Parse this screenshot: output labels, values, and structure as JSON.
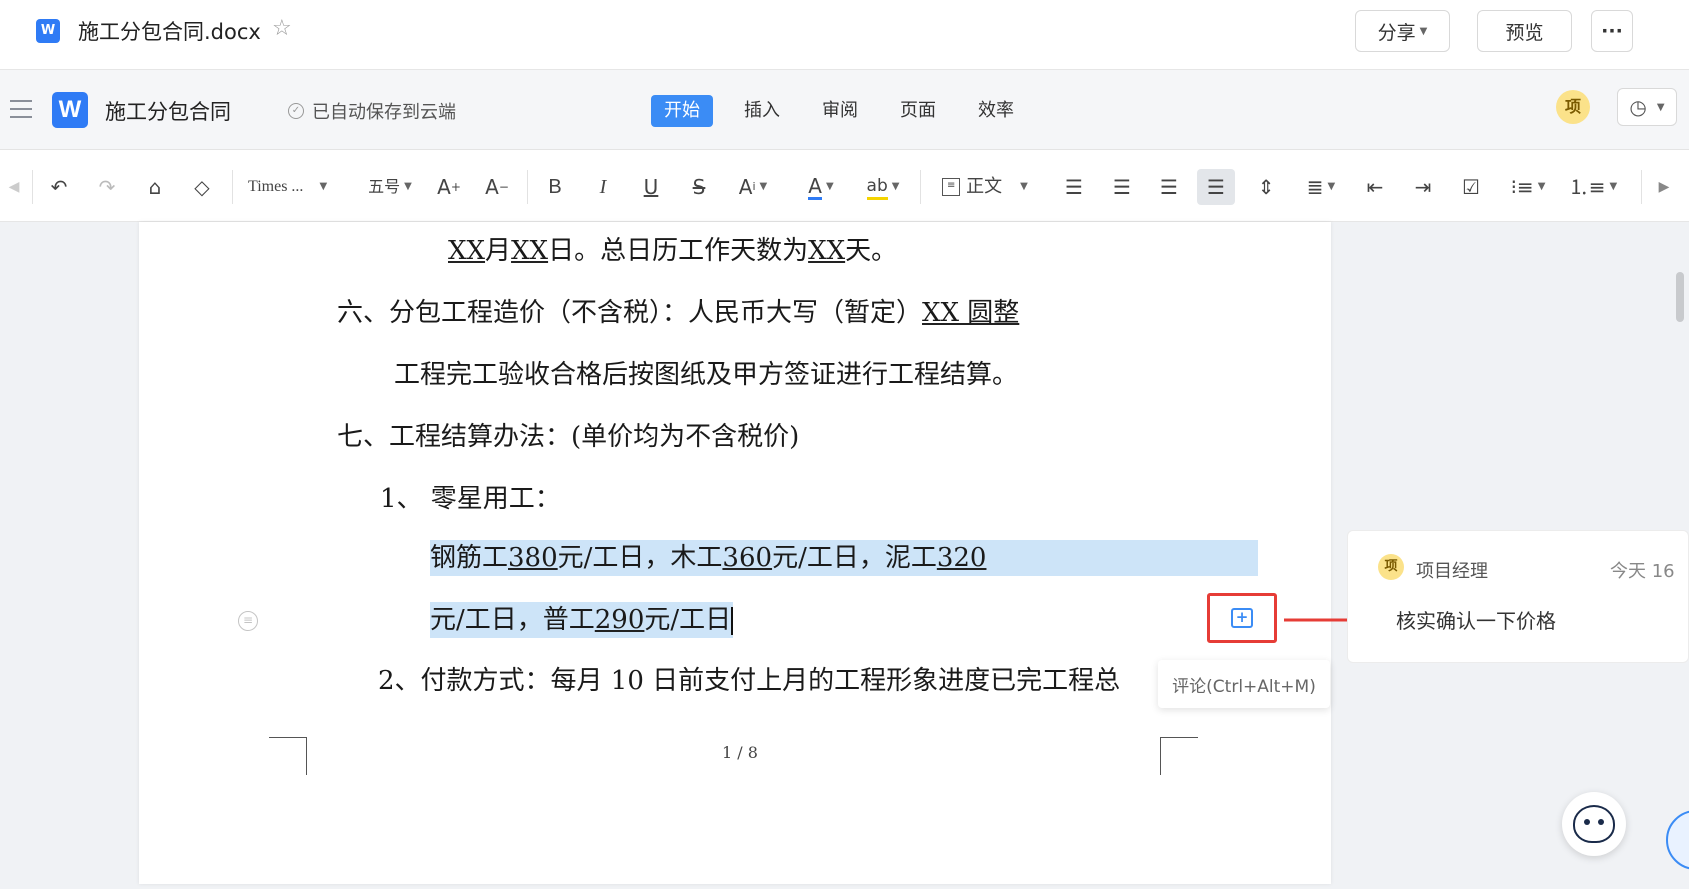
{
  "titlebar": {
    "doc_icon": "W",
    "doc_name": "施工分包合同.docx",
    "share_label": "分享",
    "preview_label": "预览",
    "more_label": "···"
  },
  "menubar": {
    "app_title": "施工分包合同",
    "save_status": "已自动保存到云端",
    "tabs": [
      "开始",
      "插入",
      "审阅",
      "页面",
      "效率"
    ],
    "active_tab": "开始",
    "avatar_label": "项"
  },
  "toolbar": {
    "font_name": "Times ...",
    "font_size": "五号",
    "paragraph_style": "正文",
    "icons": [
      "undo-icon",
      "redo-icon",
      "format-painter-icon",
      "eraser-icon",
      "grow-font-icon",
      "shrink-font-icon",
      "bold-icon",
      "italic-icon",
      "underline-icon",
      "strikethrough-icon",
      "superscript-icon",
      "font-color-icon",
      "highlight-icon",
      "align-left-icon",
      "align-center-icon",
      "align-right-icon",
      "justify-icon",
      "line-spacing-icon",
      "paragraph-spacing-icon",
      "outdent-icon",
      "indent-icon",
      "checklist-icon",
      "bullet-list-icon",
      "numbered-list-icon"
    ],
    "font_color": "#2f7bf5",
    "highlight_color": "#f5d400"
  },
  "document": {
    "line1": {
      "a": "XX",
      "b": "月",
      "c": "XX",
      "d": "日。总日历工作天数为",
      "e": "XX",
      "f": "天。"
    },
    "line2": {
      "a": "六、分包工程造价（不含税）：人民币大写（暂定）",
      "b": "XX 圆整"
    },
    "line3": "工程完工验收合格后按图纸及甲方签证进行工程结算。",
    "line4": "七、工程结算办法：(单价均为不含税价)",
    "line5": "1、 零星用工：",
    "line6": {
      "a": "钢筋工",
      "b": "380",
      "c": "元/工日，木工",
      "d": "360",
      "e": "元/工日，泥工",
      "f": "320"
    },
    "line7": {
      "a": "元/工日，普工",
      "b": "290",
      "c": "元/工日"
    },
    "line8": "2、付款方式：每月 10 日前支付上月的工程形象进度已完工程总",
    "page_number": "1 / 8"
  },
  "tooltip": "评论(Ctrl+Alt+M)",
  "comment": {
    "avatar": "项",
    "author": "项目经理",
    "time": "今天 16",
    "text": "核实确认一下价格"
  },
  "colors": {
    "accent": "#3b8cf5",
    "selection": "#cde4f8",
    "annotation_red": "#e63c36"
  }
}
